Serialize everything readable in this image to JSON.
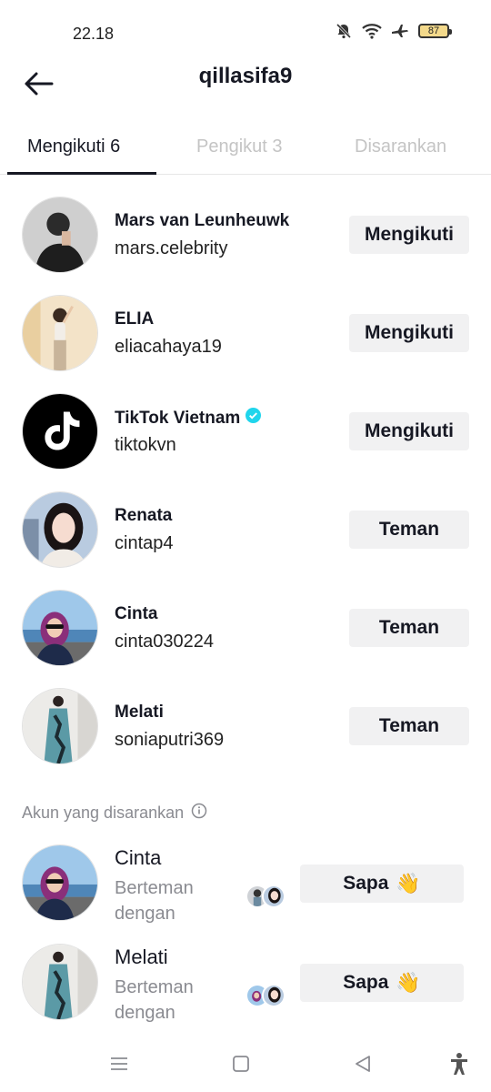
{
  "status_bar": {
    "time": "22.18",
    "battery": "87"
  },
  "header": {
    "title": "qillasifa9"
  },
  "tabs": [
    {
      "label": "Mengikuti 6",
      "active": true
    },
    {
      "label": "Pengikut 3",
      "active": false
    },
    {
      "label": "Disarankan",
      "active": false
    }
  ],
  "following": [
    {
      "name": "Mars van Leunheuwk",
      "handle": "mars.celebrity",
      "button": "Mengikuti"
    },
    {
      "name": "ELIA",
      "handle": "eliacahaya19",
      "button": "Mengikuti"
    },
    {
      "name": "TikTok Vietnam",
      "handle": "tiktokvn",
      "button": "Mengikuti",
      "verified": true
    },
    {
      "name": "Renata",
      "handle": "cintap4",
      "button": "Teman"
    },
    {
      "name": "Cinta",
      "handle": "cinta030224",
      "button": "Teman"
    },
    {
      "name": "Melati",
      "handle": "soniaputri369",
      "button": "Teman"
    }
  ],
  "suggested": {
    "title": "Akun yang disarankan",
    "items": [
      {
        "name": "Cinta",
        "subtitle": "Berteman dengan",
        "button": "Sapa",
        "emoji": "👋"
      },
      {
        "name": "Melati",
        "subtitle": "Berteman dengan",
        "button": "Sapa",
        "emoji": "👋"
      }
    ]
  },
  "colors": {
    "verified": "#20d5ec",
    "active_tab": "#161823",
    "inactive_tab": "#c4c4c4",
    "button_bg": "#f1f1f2"
  }
}
